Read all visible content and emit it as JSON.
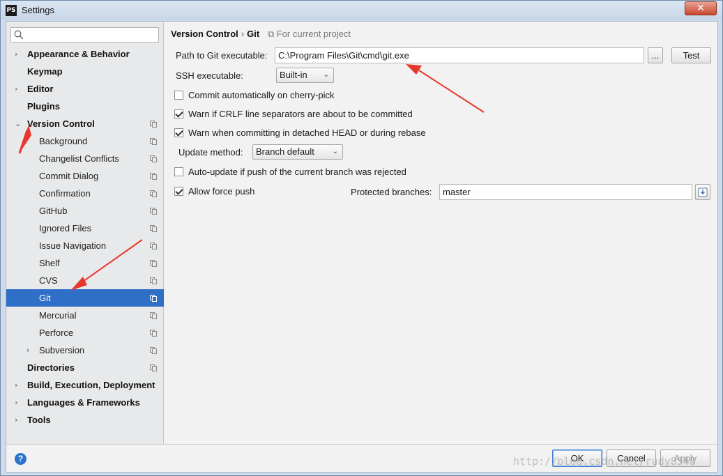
{
  "window": {
    "title": "Settings",
    "app_icon": "PS"
  },
  "search": {
    "placeholder": ""
  },
  "tree": [
    {
      "label": "Appearance & Behavior",
      "level": 0,
      "arrow": "›",
      "proj": false
    },
    {
      "label": "Keymap",
      "level": 0,
      "arrow": "",
      "proj": false
    },
    {
      "label": "Editor",
      "level": 0,
      "arrow": "›",
      "proj": false
    },
    {
      "label": "Plugins",
      "level": 0,
      "arrow": "",
      "proj": false
    },
    {
      "label": "Version Control",
      "level": 0,
      "arrow": "⌄",
      "proj": true
    },
    {
      "label": "Background",
      "level": 1,
      "arrow": "",
      "proj": true
    },
    {
      "label": "Changelist Conflicts",
      "level": 1,
      "arrow": "",
      "proj": true
    },
    {
      "label": "Commit Dialog",
      "level": 1,
      "arrow": "",
      "proj": true
    },
    {
      "label": "Confirmation",
      "level": 1,
      "arrow": "",
      "proj": true
    },
    {
      "label": "GitHub",
      "level": 1,
      "arrow": "",
      "proj": true
    },
    {
      "label": "Ignored Files",
      "level": 1,
      "arrow": "",
      "proj": true
    },
    {
      "label": "Issue Navigation",
      "level": 1,
      "arrow": "",
      "proj": true
    },
    {
      "label": "Shelf",
      "level": 1,
      "arrow": "",
      "proj": true
    },
    {
      "label": "CVS",
      "level": 1,
      "arrow": "",
      "proj": true
    },
    {
      "label": "Git",
      "level": 1,
      "arrow": "",
      "proj": true,
      "selected": true
    },
    {
      "label": "Mercurial",
      "level": 1,
      "arrow": "",
      "proj": true
    },
    {
      "label": "Perforce",
      "level": 1,
      "arrow": "",
      "proj": true
    },
    {
      "label": "Subversion",
      "level": 1,
      "arrow": "›",
      "proj": true
    },
    {
      "label": "Directories",
      "level": 0,
      "arrow": "",
      "proj": true
    },
    {
      "label": "Build, Execution, Deployment",
      "level": 0,
      "arrow": "›",
      "proj": false
    },
    {
      "label": "Languages & Frameworks",
      "level": 0,
      "arrow": "›",
      "proj": false
    },
    {
      "label": "Tools",
      "level": 0,
      "arrow": "›",
      "proj": false
    }
  ],
  "breadcrumb": {
    "parent": "Version Control",
    "separator": "›",
    "current": "Git",
    "scope": "For current project"
  },
  "git": {
    "path_label": "Path to Git executable:",
    "path_value": "C:\\Program Files\\Git\\cmd\\git.exe",
    "browse_label": "...",
    "test_label": "Test",
    "ssh_label": "SSH executable:",
    "ssh_value": "Built-in",
    "commit_cherry_pick": {
      "label": "Commit automatically on cherry-pick",
      "checked": false
    },
    "warn_crlf": {
      "label": "Warn if CRLF line separators are about to be committed",
      "checked": true
    },
    "warn_detached": {
      "label": "Warn when committing in detached HEAD or during rebase",
      "checked": true
    },
    "update_method_label": "Update method:",
    "update_method_value": "Branch default",
    "auto_update": {
      "label": "Auto-update if push of the current branch was rejected",
      "checked": false
    },
    "allow_force_push": {
      "label": "Allow force push",
      "checked": true
    },
    "protected_label": "Protected branches:",
    "protected_value": "master"
  },
  "footer": {
    "help": "?",
    "ok": "OK",
    "cancel": "Cancel",
    "apply": "Apply"
  },
  "watermark": "http://blog.csdn.net/rudy8348",
  "colors": {
    "selection": "#2f6fc8",
    "annotation_arrow": "#e8372c"
  }
}
